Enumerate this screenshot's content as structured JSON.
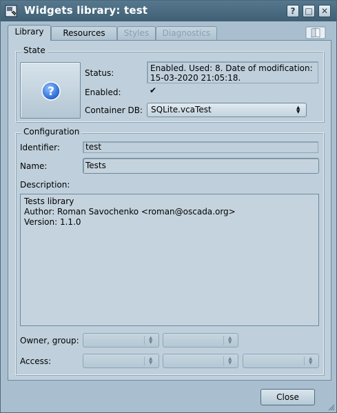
{
  "window": {
    "title": "Widgets library: test"
  },
  "title_buttons": {
    "help": "?",
    "maximize": "□",
    "close": "✕"
  },
  "tabs": [
    {
      "label": "Library",
      "active": true,
      "enabled": true
    },
    {
      "label": "Resources",
      "active": false,
      "enabled": true
    },
    {
      "label": "Styles",
      "active": false,
      "enabled": false
    },
    {
      "label": "Diagnostics",
      "active": false,
      "enabled": false
    }
  ],
  "state": {
    "group_title": "State",
    "status_label": "Status:",
    "status_value": "Enabled. Used: 8. Date of modification:\n15-03-2020 21:05:18.",
    "enabled_label": "Enabled:",
    "enabled_checked": true,
    "enabled_mark": "✔",
    "container_db_label": "Container DB:",
    "container_db_value": "SQLite.vcaTest"
  },
  "configuration": {
    "group_title": "Configuration",
    "identifier_label": "Identifier:",
    "identifier_value": "test",
    "name_label": "Name:",
    "name_value": "Tests",
    "description_label": "Description:",
    "description_value": "Tests library\nAuthor: Roman Savochenko <roman@oscada.org>\nVersion: 1.1.0",
    "owner_group_label": "Owner, group:",
    "access_label": "Access:"
  },
  "footer": {
    "close_label": "Close"
  },
  "colors": {
    "titlebar": "#4a6b80",
    "window_bg": "#a9bfcf",
    "panel_bg": "#bfd0dc",
    "accent_icon": "#2f6fd6"
  },
  "icons": {
    "app": "widget-library-icon",
    "big_button": "question-icon",
    "tab_corner": "book-icon"
  }
}
